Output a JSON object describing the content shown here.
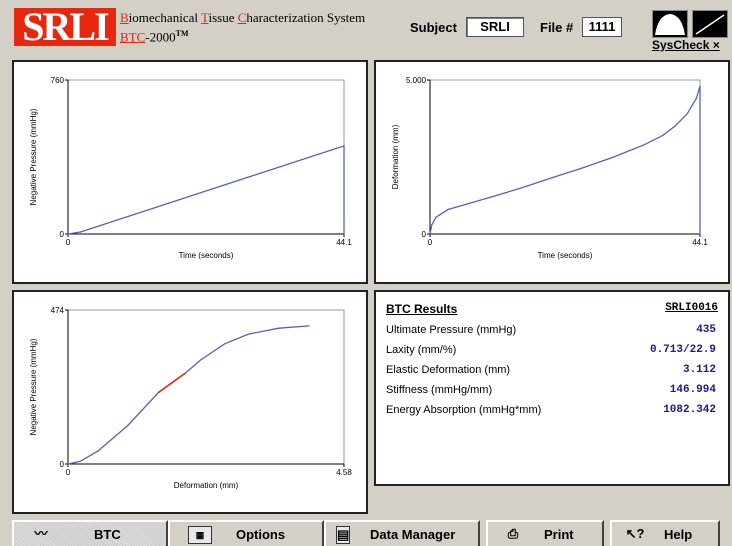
{
  "header": {
    "logo": "SRLI",
    "title_line1": [
      "B",
      "iomechanical ",
      "T",
      "issue ",
      "C",
      "haracterization System"
    ],
    "title_line2_a": "BTC",
    "title_line2_b": "-2000",
    "tm": "TM",
    "subject_label": "Subject",
    "subject_value": "SRLI",
    "file_label": "File #",
    "file_value": "1111",
    "syscheck": "SysCheck ×"
  },
  "plots": {
    "p1": {
      "ymax_label": "760",
      "ymin_label": "0",
      "xmin_label": "0",
      "xmax_label": "44.1",
      "xlabel": "Time (seconds)",
      "ylabel": "Negative Pressure (mmHg)"
    },
    "p2": {
      "ymax_label": "5.000",
      "ymin_label": "0",
      "xmin_label": "0",
      "xmax_label": "44.1",
      "xlabel": "Time (seconds)",
      "ylabel": "Deformation (mm)"
    },
    "p3": {
      "ymax_label": "474",
      "ymin_label": "0",
      "xmin_label": "0",
      "xmax_label": "4.58",
      "xlabel": "Deformation (mm)",
      "ylabel": "Negative Pressure (mmHg)"
    }
  },
  "chart_data": [
    {
      "type": "line",
      "xlabel": "Time (seconds)",
      "ylabel": "Negative Pressure (mmHg)",
      "xlim": [
        0,
        44.1
      ],
      "ylim": [
        0,
        760
      ],
      "x": [
        0,
        2,
        44.1,
        44.1
      ],
      "y": [
        0,
        10,
        435,
        0
      ]
    },
    {
      "type": "line",
      "xlabel": "Time (seconds)",
      "ylabel": "Deformation (mm)",
      "xlim": [
        0,
        44.1
      ],
      "ylim": [
        0,
        5.0
      ],
      "x": [
        0,
        0.3,
        1,
        3,
        6,
        10,
        15,
        20,
        25,
        30,
        35,
        38,
        40,
        42,
        43.5,
        44.1,
        44.1
      ],
      "y": [
        0,
        0.3,
        0.55,
        0.8,
        0.97,
        1.2,
        1.5,
        1.83,
        2.15,
        2.5,
        2.9,
        3.2,
        3.5,
        3.9,
        4.4,
        4.8,
        0
      ]
    },
    {
      "type": "line",
      "xlabel": "Deformation (mm)",
      "ylabel": "Negative Pressure (mmHg)",
      "xlim": [
        0,
        4.58
      ],
      "ylim": [
        0,
        474
      ],
      "x": [
        0,
        0.2,
        0.5,
        1.0,
        1.5,
        1.95,
        2.2,
        2.6,
        3.0,
        3.5,
        4.0
      ],
      "y": [
        0,
        8,
        40,
        120,
        220,
        280,
        320,
        370,
        400,
        418,
        425
      ]
    }
  ],
  "results": {
    "title": "BTC Results",
    "id": "SRLI0016",
    "rows": [
      {
        "label": "Ultimate Pressure (mmHg)",
        "value": "435"
      },
      {
        "label": "Laxity (mm/%)",
        "value": "0.713/22.9"
      },
      {
        "label": "Elastic Deformation (mm)",
        "value": "3.112"
      },
      {
        "label": "Stiffness (mmHg/mm)",
        "value": "146.994"
      },
      {
        "label": "Energy Absorption (mmHg*mm)",
        "value": "1082.342"
      }
    ]
  },
  "tabs": [
    {
      "label": "BTC",
      "icon": "btc-chart-icon"
    },
    {
      "label": "Options",
      "icon": "options-icon"
    },
    {
      "label": "Data Manager",
      "icon": "data-manager-icon"
    },
    {
      "label": "Print",
      "icon": "printer-icon"
    },
    {
      "label": "Help",
      "icon": "help-pointer-icon"
    }
  ],
  "colors": {
    "accent": "#e8280e",
    "curve": "#5560c0",
    "highlight": "#e8280e",
    "value": "#1a1a8c"
  }
}
